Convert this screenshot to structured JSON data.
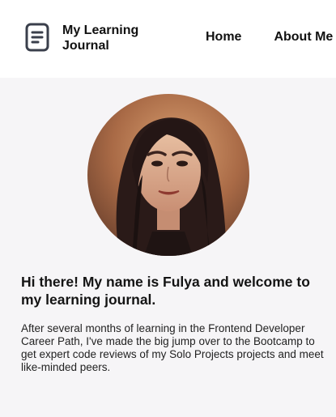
{
  "header": {
    "brand_title": "My Learning Journal",
    "logo_icon": "document-icon",
    "nav": [
      {
        "label": "Home"
      },
      {
        "label": "About Me"
      }
    ]
  },
  "hero": {
    "avatar_icon": "profile-photo",
    "headline": "Hi there! My name is Fulya and welcome to my learning journal.",
    "intro": "After several months of learning in the Frontend Developer Career Path, I've made the big jump over to the Bootcamp to get expert code reviews of my Solo Projects projects and meet like-minded peers."
  },
  "colors": {
    "header_bg": "#ffffff",
    "page_bg": "#f6f5f7",
    "text": "#111111"
  }
}
